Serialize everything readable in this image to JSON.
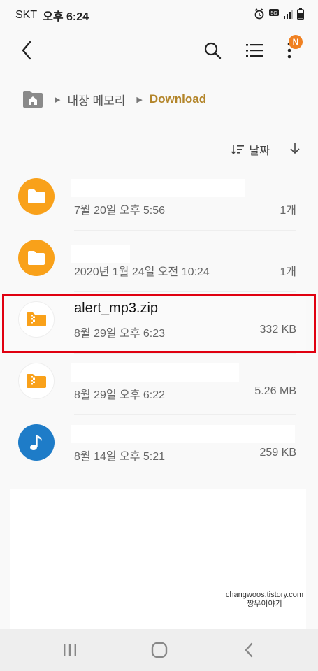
{
  "status_bar": {
    "carrier": "SKT",
    "time": "오후 6:24"
  },
  "toolbar": {
    "back_icon": "back-arrow-icon",
    "search_icon": "search-icon",
    "list_icon": "list-view-icon",
    "more_icon": "more-vert-icon",
    "notification_badge": "N"
  },
  "breadcrumb": {
    "home_icon": "home-folder-icon",
    "storage": "내장 메모리",
    "current": "Download"
  },
  "sort": {
    "label": "날짜",
    "sort_icon": "sort-icon",
    "order_icon": "arrow-down-icon"
  },
  "files": [
    {
      "name": "",
      "type": "folder",
      "date": "7월 20일 오후 5:56",
      "size": "1개"
    },
    {
      "name": "",
      "type": "folder",
      "date": "2020년 1월 24일 오전 10:24",
      "size": "1개"
    },
    {
      "name": "alert_mp3.zip",
      "type": "zip",
      "date": "8월 29일 오후 6:23",
      "size": "332 KB"
    },
    {
      "name": "",
      "type": "zip",
      "date": "8월 29일 오후 6:22",
      "size": "5.26 MB"
    },
    {
      "name": "",
      "type": "audio",
      "date": "8월 14일 오후 5:21",
      "size": "259 KB"
    }
  ],
  "watermark": {
    "line1": "changwoos.tistory.com",
    "line2": "짱우이야기"
  },
  "colors": {
    "accent": "#b3852a",
    "folder": "#f9a11a",
    "audio": "#1e7cc8",
    "highlight": "#e00010",
    "badge": "#f08122"
  }
}
